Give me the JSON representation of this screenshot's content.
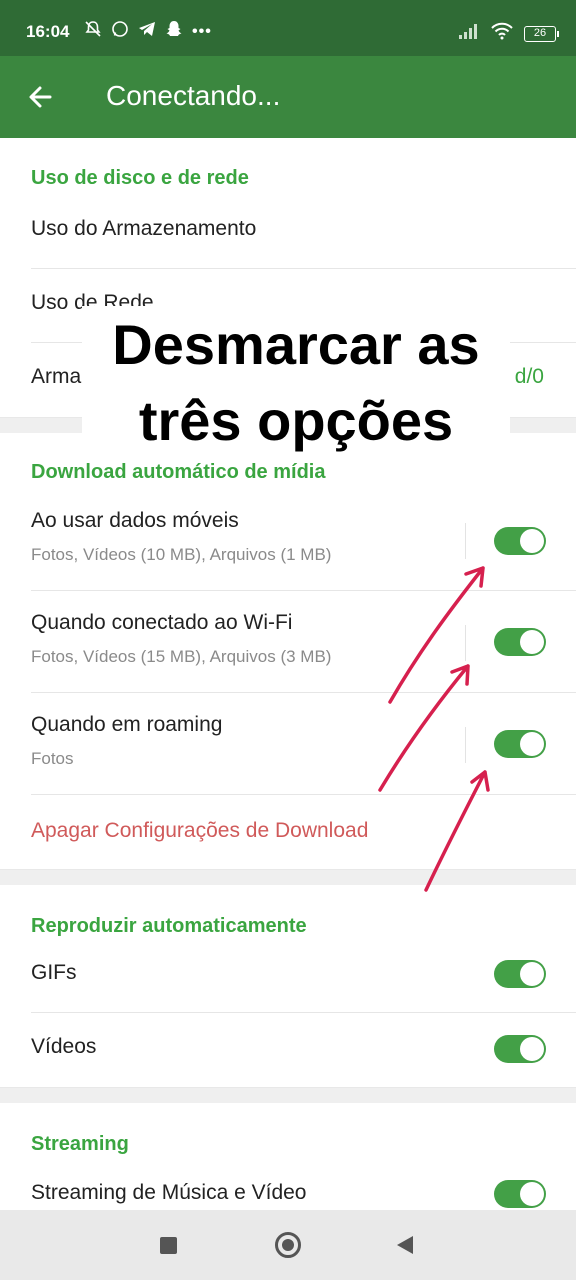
{
  "status_bar": {
    "time": "16:04",
    "battery": "26",
    "icons": [
      "notifications-off-icon",
      "whatsapp-icon",
      "telegram-icon",
      "snapchat-icon",
      "more-icon",
      "signal-icon",
      "wifi-icon",
      "battery-icon"
    ]
  },
  "app_bar": {
    "title": "Conectando..."
  },
  "sections": {
    "disk": {
      "header": "Uso de disco e de rede",
      "storage_usage": "Uso do Armazenamento",
      "network_usage": "Uso de Rede",
      "storage_path": "Armazenamento",
      "storage_path_value": "d/0"
    },
    "auto_download": {
      "header": "Download automático de mídia",
      "mobile_label": "Ao usar dados móveis",
      "mobile_sub": "Fotos, Vídeos (10 MB), Arquivos (1 MB)",
      "mobile_on": true,
      "wifi_label": "Quando conectado ao Wi-Fi",
      "wifi_sub": "Fotos, Vídeos (15 MB), Arquivos (3 MB)",
      "wifi_on": true,
      "roaming_label": "Quando em roaming",
      "roaming_sub": "Fotos",
      "roaming_on": true,
      "reset": "Apagar Configurações de Download"
    },
    "autoplay": {
      "header": "Reproduzir automaticamente",
      "gifs": "GIFs",
      "gifs_on": true,
      "videos": "Vídeos",
      "videos_on": true
    },
    "streaming": {
      "header": "Streaming",
      "music_video": "Streaming de Música e Vídeo",
      "music_video_on": true
    }
  },
  "annotation": {
    "text_line1": "Desmarcar as",
    "text_line2": "três opções"
  },
  "colors": {
    "statusbar": "#2f6b35",
    "appbar": "#3b873f",
    "accent": "#3aa540",
    "toggle_on": "#43a047",
    "reset": "#d05a5a",
    "arrow": "#d6204e"
  }
}
